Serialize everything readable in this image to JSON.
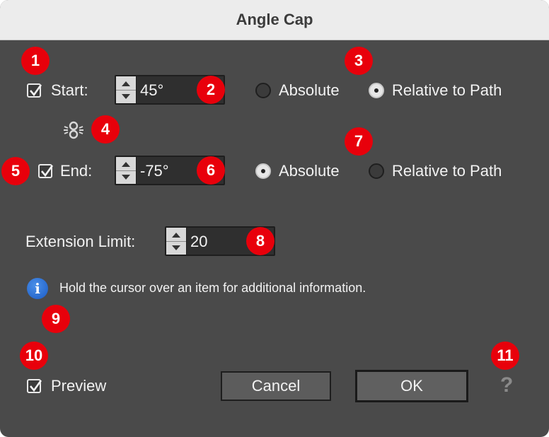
{
  "window": {
    "title": "Angle Cap"
  },
  "start": {
    "label": "Start:",
    "checked": true,
    "value": "45°",
    "options": [
      "Absolute",
      "Relative to Path"
    ],
    "selected": "Relative to Path"
  },
  "end": {
    "label": "End:",
    "checked": true,
    "value": "-75°",
    "options": [
      "Absolute",
      "Relative to Path"
    ],
    "selected": "Absolute"
  },
  "link_icon": "link-icon",
  "extension": {
    "label": "Extension Limit:",
    "value": "20"
  },
  "info": {
    "icon": "info-icon",
    "text": "Hold the cursor over an item for additional information."
  },
  "preview": {
    "label": "Preview",
    "checked": true
  },
  "buttons": {
    "cancel": "Cancel",
    "ok": "OK"
  },
  "help_icon": "help-icon",
  "annotations": [
    "1",
    "2",
    "3",
    "4",
    "5",
    "6",
    "7",
    "8",
    "9",
    "10",
    "11"
  ],
  "colors": {
    "badge": "#e8000b",
    "window_bg": "#4a4a4a",
    "titlebar": "#ececec"
  }
}
